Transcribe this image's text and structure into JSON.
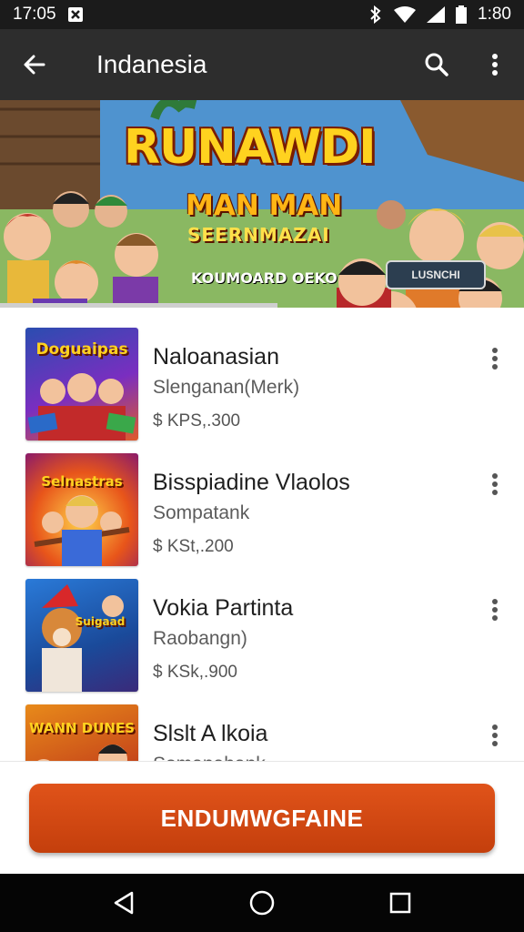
{
  "status_bar": {
    "time": "17:05",
    "battery_time": "1:80"
  },
  "app_bar": {
    "title": "Indanesia"
  },
  "banner": {
    "title": "RUNAWDI",
    "subtitle": "MAN MAN",
    "subtitle2": "SEERNMAZAI",
    "tagline": "KOUMOARD OEKO",
    "button_label": "LUSNCHI"
  },
  "list": {
    "items": [
      {
        "name": "Naloanasian",
        "developer": "Slenganan(Merk)",
        "price": "$ KPS,.300",
        "thumb_text": "Doguaipas"
      },
      {
        "name": "Bisspiadine Vlaolos",
        "developer": "Sompatank",
        "price": "$ KSt,.200",
        "thumb_text": "Selnastras"
      },
      {
        "name": "Vokia Partinta",
        "developer": "Raobangn)",
        "price": "$ KSk,.900",
        "thumb_text": "Suigaad"
      },
      {
        "name": "Slslt A lkoia",
        "developer": "Somanahank",
        "price": "",
        "thumb_text": "WANN DUNES"
      }
    ]
  },
  "cta": {
    "label": "ENDUMWGFAINE"
  },
  "colors": {
    "accent": "#d44914",
    "app_bar": "#2d2d2d",
    "status_bar": "#1b1b1b"
  },
  "icons": [
    "back-arrow-icon",
    "search-icon",
    "overflow-menu-icon",
    "nav-back-icon",
    "nav-home-icon",
    "nav-recents-icon"
  ]
}
